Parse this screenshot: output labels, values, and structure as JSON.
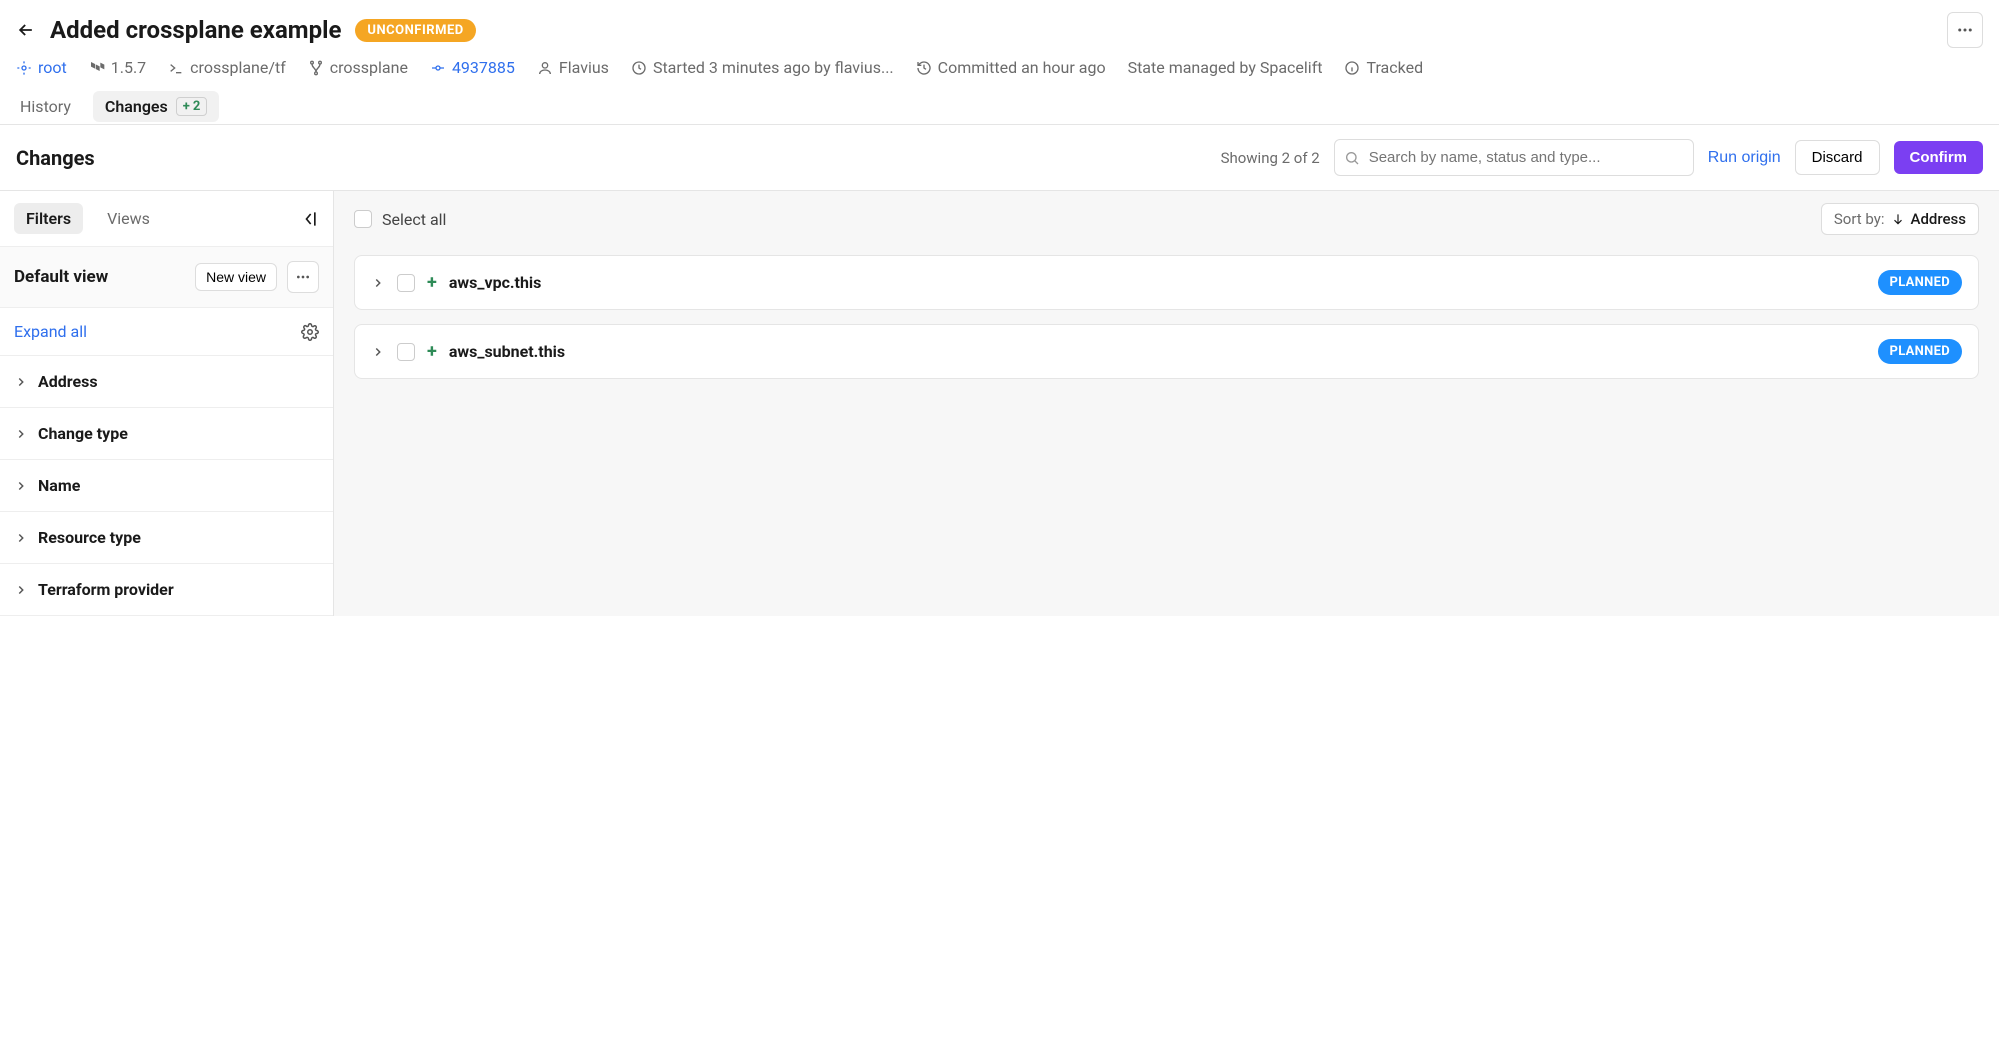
{
  "header": {
    "title": "Added crossplane example",
    "status_badge": "UNCONFIRMED"
  },
  "meta": {
    "root": "root",
    "version": "1.5.7",
    "path": "crossplane/tf",
    "branch": "crossplane",
    "commit": "4937885",
    "user": "Flavius",
    "started": "Started 3 minutes ago by flavius...",
    "committed": "Committed an hour ago",
    "state": "State managed by Spacelift",
    "tracked": "Tracked"
  },
  "tabs": {
    "history": "History",
    "changes": "Changes",
    "changes_count": "2"
  },
  "toolbar": {
    "title": "Changes",
    "showing": "Showing 2 of 2",
    "search_placeholder": "Search by name, status and type...",
    "run_origin": "Run origin",
    "discard": "Discard",
    "confirm": "Confirm"
  },
  "sidebar": {
    "tab_filters": "Filters",
    "tab_views": "Views",
    "view_title": "Default view",
    "new_view": "New view",
    "expand_all": "Expand all",
    "filters": [
      "Address",
      "Change type",
      "Name",
      "Resource type",
      "Terraform provider"
    ]
  },
  "main": {
    "select_all": "Select all",
    "sort_label": "Sort by:",
    "sort_value": "Address",
    "resources": [
      {
        "name": "aws_vpc.this",
        "status": "PLANNED"
      },
      {
        "name": "aws_subnet.this",
        "status": "PLANNED"
      }
    ]
  }
}
